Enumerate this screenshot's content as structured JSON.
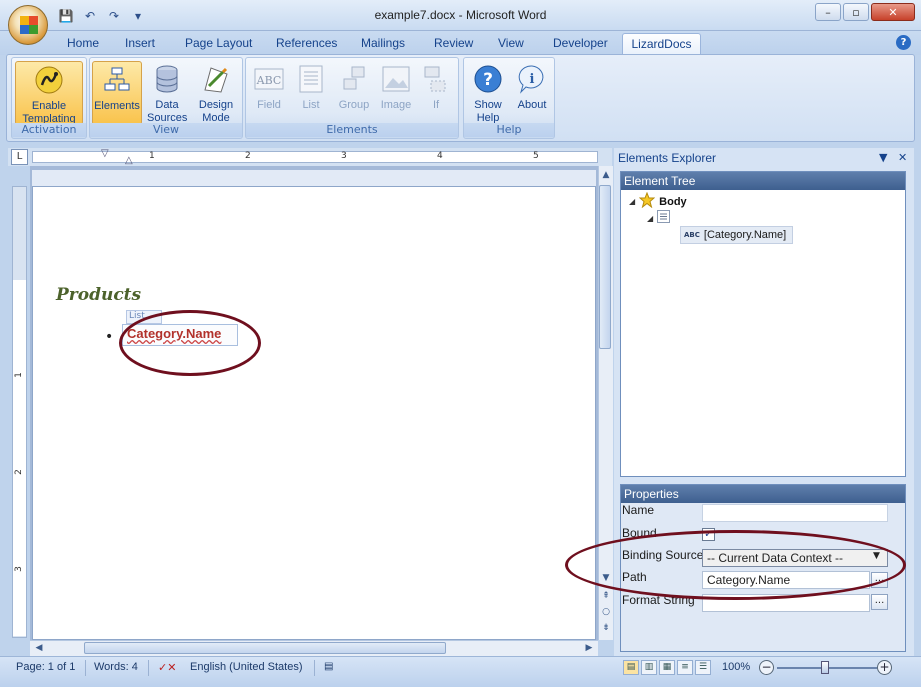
{
  "window": {
    "title": "example7.docx - Microsoft Word"
  },
  "tabs": [
    "Home",
    "Insert",
    "Page Layout",
    "References",
    "Mailings",
    "Review",
    "View",
    "Developer",
    "LizardDocs"
  ],
  "ribbon": {
    "groups": [
      {
        "label": "Activation",
        "buttons": [
          {
            "label": "Enable Templating",
            "icon": "lizard-icon",
            "active": true
          }
        ]
      },
      {
        "label": "View",
        "buttons": [
          {
            "label": "Elements",
            "icon": "elements-icon",
            "active": true
          },
          {
            "label": "Data Sources",
            "icon": "database-icon"
          },
          {
            "label": "Design Mode",
            "icon": "design-mode-icon"
          }
        ]
      },
      {
        "label": "Elements",
        "buttons": [
          {
            "label": "Field",
            "icon": "abc-field-icon",
            "disabled": true
          },
          {
            "label": "List",
            "icon": "list-icon",
            "disabled": true
          },
          {
            "label": "Group",
            "icon": "group-icon",
            "disabled": true
          },
          {
            "label": "Image",
            "icon": "image-icon",
            "disabled": true
          },
          {
            "label": "If",
            "icon": "if-icon",
            "disabled": true
          }
        ]
      },
      {
        "label": "Help",
        "buttons": [
          {
            "label": "Show Help",
            "icon": "help-icon"
          },
          {
            "label": "About",
            "icon": "info-icon"
          }
        ]
      }
    ]
  },
  "ruler": {
    "numbers": [
      "1",
      "2",
      "3",
      "4",
      "5"
    ],
    "vnumbers": [
      "1",
      "2",
      "3"
    ]
  },
  "document": {
    "heading": "Products",
    "list_tag": "List",
    "field_text": "Category.Name"
  },
  "explorer": {
    "title": "Elements Explorer",
    "tree_header": "Element Tree",
    "tree": {
      "root": "Body",
      "field": "[Category.Name]"
    },
    "props_header": "Properties",
    "props": {
      "name_label": "Name",
      "name_value": "",
      "bound_label": "Bound",
      "bound_checked": "✓",
      "binding_label": "Binding Source",
      "binding_value": "-- Current Data Context --",
      "path_label": "Path",
      "path_value": "Category.Name",
      "format_label": "Format String",
      "format_value": ""
    }
  },
  "status": {
    "page": "Page: 1 of 1",
    "words": "Words: 4",
    "language": "English (United States)",
    "zoom": "100%"
  }
}
